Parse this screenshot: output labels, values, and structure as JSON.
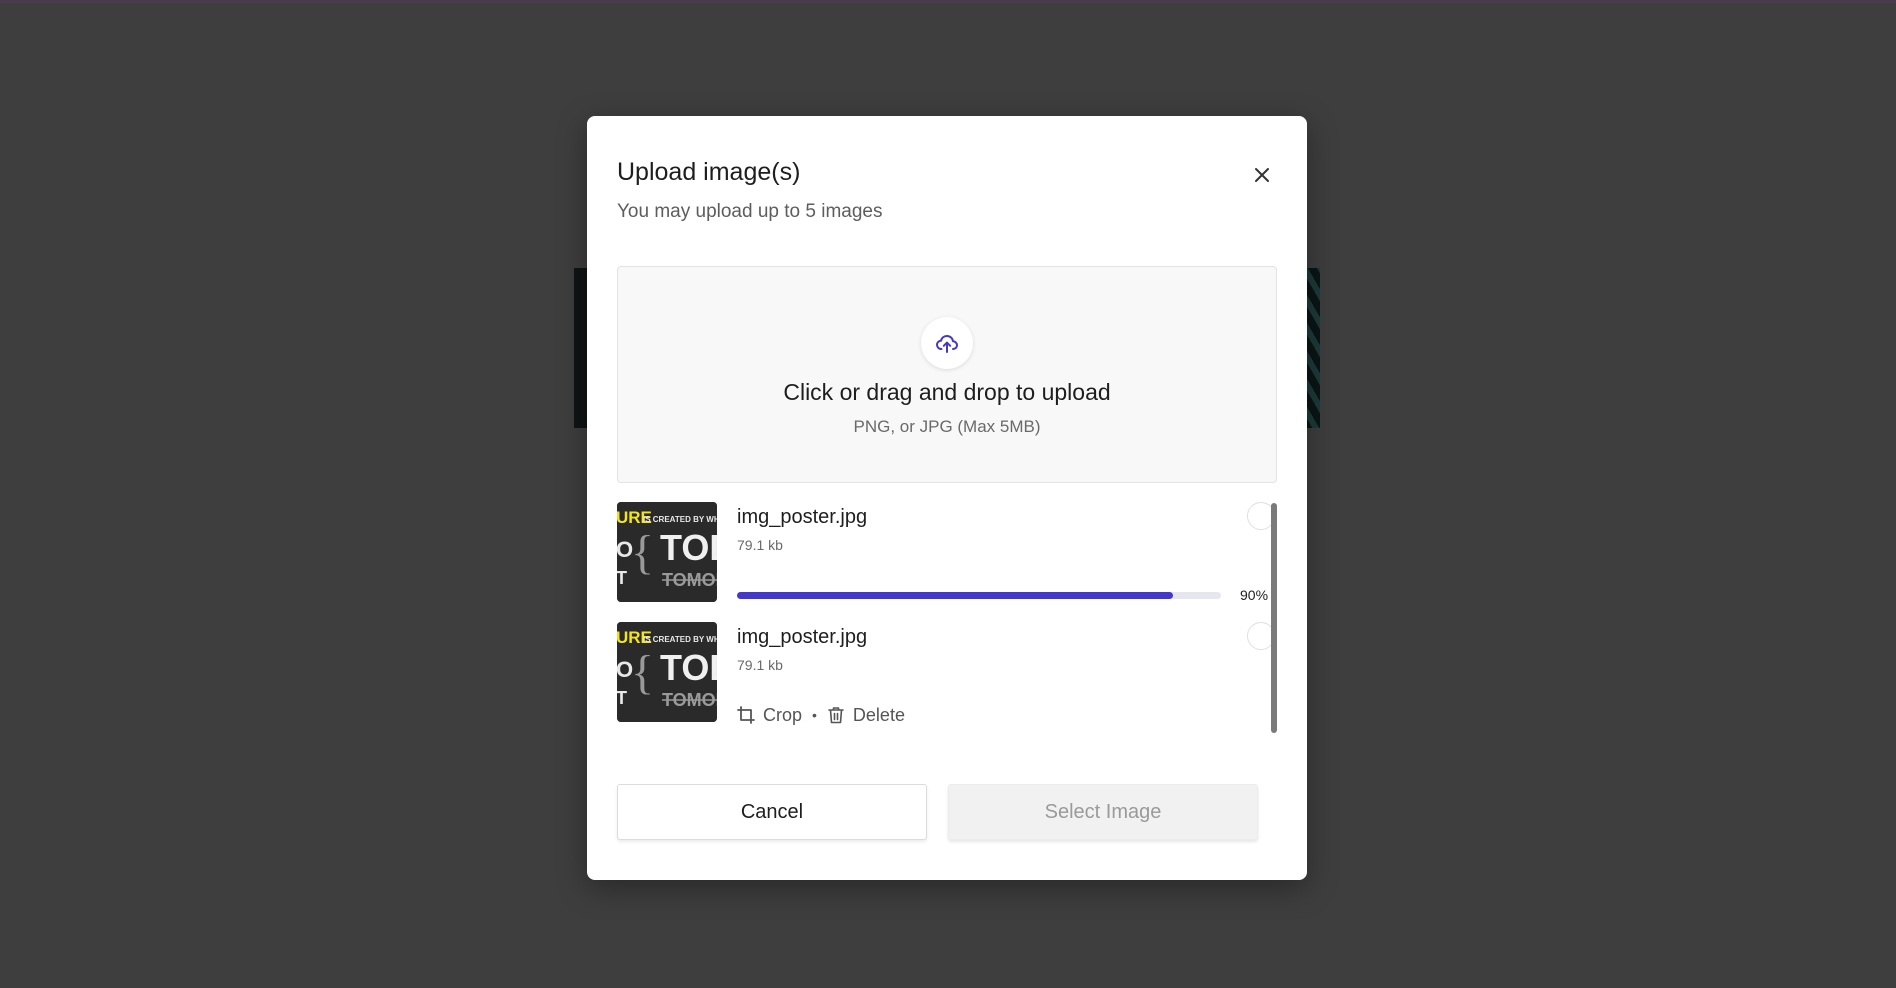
{
  "dialog": {
    "title": "Upload image(s)",
    "subtitle": "You may upload up to 5 images",
    "close_icon": "close-icon"
  },
  "dropzone": {
    "icon": "cloud-upload-icon",
    "main_text": "Click or drag and drop to upload",
    "sub_text": "PNG, or JPG (Max 5MB)"
  },
  "files": [
    {
      "name": "img_poster.jpg",
      "size": "79.1 kb",
      "status": "uploading",
      "progress_percent": 90,
      "progress_label": "90%"
    },
    {
      "name": "img_poster.jpg",
      "size": "79.1 kb",
      "status": "uploaded",
      "crop_label": "Crop",
      "separator": "•",
      "delete_label": "Delete"
    }
  ],
  "thumbnail": {
    "line1_highlight": "URE",
    "line1_rest": "IS CREATED BY WHAT",
    "line2_left": "O",
    "line2_brace": "{",
    "line2_word": "TOD",
    "line3_left": "T",
    "line3_word": "TOMORR"
  },
  "buttons": {
    "cancel_label": "Cancel",
    "select_label": "Select Image"
  },
  "colors": {
    "accent": "#4338ca",
    "backdrop": "#3e3e3e",
    "thumb_highlight": "#f2e51b"
  }
}
